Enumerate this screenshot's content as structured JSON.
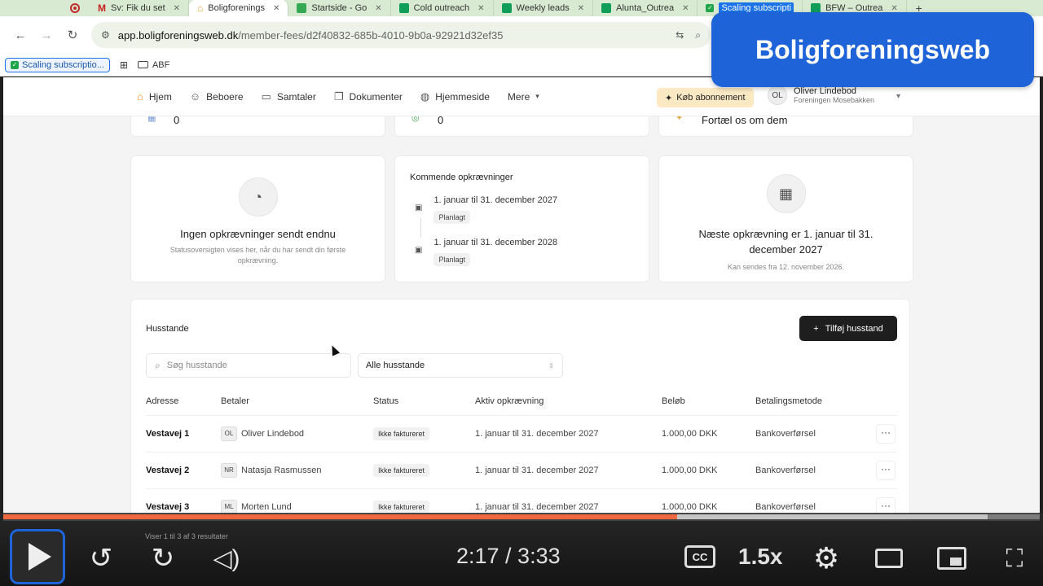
{
  "browser": {
    "tabs": [
      {
        "label": "",
        "icon": "record-icon"
      },
      {
        "label": "Sv: Fik du set",
        "icon": "gmail-icon",
        "color": "#c5221f"
      },
      {
        "label": "Boligforenings",
        "icon": "house-icon",
        "color": "#f29b2e",
        "active": true
      },
      {
        "label": "Startside - Go",
        "icon": "drive-icon",
        "color": "#34a853"
      },
      {
        "label": "Cold outreach",
        "icon": "sheets-icon",
        "color": "#0f9d58"
      },
      {
        "label": "Weekly leads",
        "icon": "sheets-icon",
        "color": "#0f9d58"
      },
      {
        "label": "Alunta_Outrea",
        "icon": "sheets-icon",
        "color": "#0f9d58"
      },
      {
        "label": "Scaling subscripti",
        "icon": "check-icon",
        "color": "#1fa64a",
        "highlight": true
      },
      {
        "label": "BFW – Outrea",
        "icon": "sheets-icon",
        "color": "#0f9d58"
      }
    ],
    "url_host": "app.boligforeningsweb.dk",
    "url_path": "/member-fees/d2f40832-685b-4010-9b0a-92921d32ef35",
    "bookmarks": {
      "chip": "Scaling subscriptio...",
      "folder": "ABF"
    }
  },
  "brand_banner": "Boligforeningsweb",
  "app": {
    "nav": {
      "items": [
        {
          "label": "Hjem",
          "icon": "home-icon"
        },
        {
          "label": "Beboere",
          "icon": "people-icon"
        },
        {
          "label": "Samtaler",
          "icon": "chat-icon"
        },
        {
          "label": "Dokumenter",
          "icon": "documents-icon"
        },
        {
          "label": "Hjemmeside",
          "icon": "globe-icon"
        },
        {
          "label": "Mere",
          "icon": "chevron-down-icon"
        }
      ],
      "buy_label": "Køb abonnement",
      "user": {
        "initials": "OL",
        "name": "Oliver Lindebod",
        "org": "Foreningen Mosebakken"
      }
    },
    "top_cards": {
      "card1_value": "0",
      "card2_value": "0",
      "card3_text": "Fortæl os om dem"
    },
    "empty_state": {
      "title": "Ingen opkrævninger sendt endnu",
      "subtitle": "Statusoversigten vises her, når du har sendt din første opkrævning."
    },
    "upcoming": {
      "title": "Kommende opkrævninger",
      "items": [
        {
          "date": "1. januar til 31. december 2027",
          "badge": "Planlagt"
        },
        {
          "date": "1. januar til 31. december 2028",
          "badge": "Planlagt"
        }
      ]
    },
    "next": {
      "title": "Næste opkrævning er 1. januar til 31. december 2027",
      "subtitle": "Kan sendes fra 12. november 2026."
    },
    "households": {
      "title": "Husstande",
      "add_button": "Tilføj husstand",
      "search_placeholder": "Søg husstande",
      "filter_value": "Alle husstande",
      "columns": [
        "Adresse",
        "Betaler",
        "Status",
        "Aktiv opkrævning",
        "Beløb",
        "Betalingsmetode"
      ],
      "rows": [
        {
          "address": "Vestavej 1",
          "initials": "OL",
          "payer": "Oliver Lindebod",
          "status": "Ikke faktureret",
          "active": "1. januar til 31. december 2027",
          "amount": "1.000,00 DKK",
          "method": "Bankoverførsel"
        },
        {
          "address": "Vestavej 2",
          "initials": "NR",
          "payer": "Natasja Rasmussen",
          "status": "Ikke faktureret",
          "active": "1. januar til 31. december 2027",
          "amount": "1.000,00 DKK",
          "method": "Bankoverførsel"
        },
        {
          "address": "Vestavej 3",
          "initials": "ML",
          "payer": "Morten Lund",
          "status": "Ikke faktureret",
          "active": "1. januar til 31. december 2027",
          "amount": "1.000,00 DKK",
          "method": "Bankoverførsel"
        }
      ],
      "footer": "Viser 1 til 3 af 3 resultater"
    }
  },
  "player": {
    "time": "2:17 / 3:33",
    "speed": "1.5x",
    "progress": 0.65,
    "buffered": 0.95,
    "accent": "#f0683f"
  }
}
